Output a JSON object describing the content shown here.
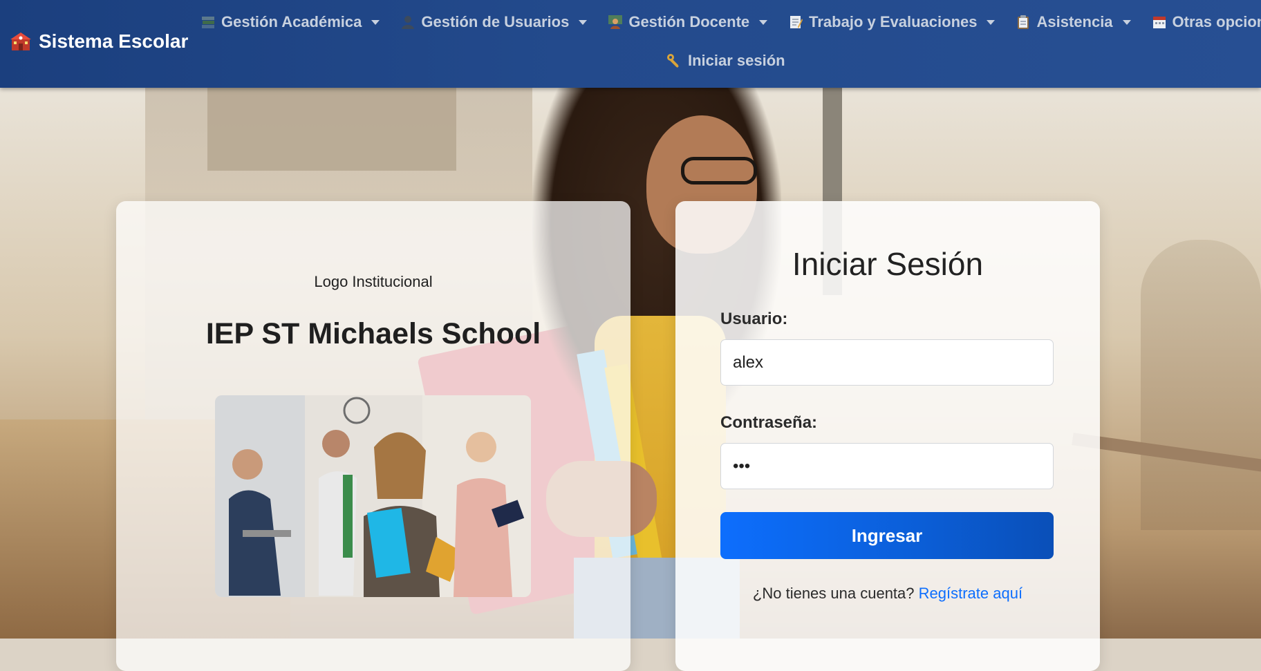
{
  "brand": {
    "title": "Sistema Escolar",
    "icon": "school-icon"
  },
  "nav": {
    "items": [
      {
        "label": "Gestión Académica",
        "icon": "books-icon"
      },
      {
        "label": "Gestión de Usuarios",
        "icon": "user-icon"
      },
      {
        "label": "Gestión Docente",
        "icon": "teacher-icon"
      },
      {
        "label": "Trabajo y Evaluaciones",
        "icon": "memo-icon"
      },
      {
        "label": "Asistencia",
        "icon": "clipboard-icon"
      },
      {
        "label": "Otras opciones",
        "icon": "calendar-icon"
      }
    ],
    "login": {
      "label": "Iniciar sesión",
      "icon": "key-icon"
    }
  },
  "info": {
    "logo_text": "Logo Institucional",
    "school_name": "IEP ST Michaels School"
  },
  "login": {
    "title": "Iniciar Sesión",
    "username_label": "Usuario:",
    "username_value": "alex",
    "password_label": "Contraseña:",
    "password_value": "abc",
    "submit_label": "Ingresar",
    "register_prompt": "¿No tienes una cuenta?",
    "register_link": "Regístrate aquí"
  },
  "colors": {
    "navbar": "#234a8c",
    "accent": "#0d6efd",
    "nav_text": "#c8d1df"
  }
}
